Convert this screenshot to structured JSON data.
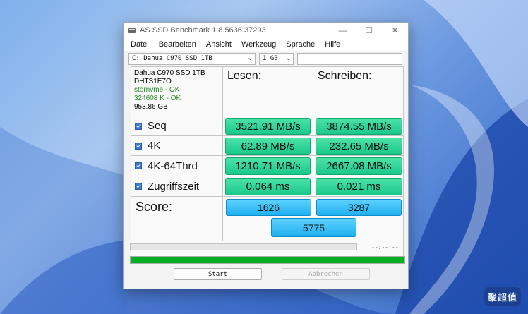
{
  "window": {
    "title": "AS SSD Benchmark 1.8.5636.37293",
    "controls": {
      "minimize": "—",
      "maximize": "☐",
      "close": "✕"
    }
  },
  "menu": [
    "Datei",
    "Bearbeiten",
    "Ansicht",
    "Werkzeug",
    "Sprache",
    "Hilfe"
  ],
  "toolbar": {
    "drive": "C: Dahua C970 SSD 1TB",
    "size": "1 GB",
    "extra": ""
  },
  "drive_info": {
    "model": "Dahua C970 SSD 1TB",
    "firmware": "DHTS1E7O",
    "driver": "stornvme - OK",
    "alignment": "324608 K - OK",
    "capacity": "953.86 GB"
  },
  "headers": {
    "read": "Lesen:",
    "write": "Schreiben:"
  },
  "tests": [
    {
      "label": "Seq",
      "read": "3521.91 MB/s",
      "write": "3874.55 MB/s"
    },
    {
      "label": "4K",
      "read": "62.89 MB/s",
      "write": "232.65 MB/s"
    },
    {
      "label": "4K-64Thrd",
      "read": "1210.71 MB/s",
      "write": "2667.08 MB/s"
    },
    {
      "label": "Zugriffszeit",
      "read": "0.064 ms",
      "write": "0.021 ms"
    }
  ],
  "score": {
    "label": "Score:",
    "read": "1626",
    "write": "3287",
    "total": "5775"
  },
  "time_readout": "--:--:--",
  "progress": 1.0,
  "buttons": {
    "start": "Start",
    "abort": "Abbrechen"
  },
  "watermark": "聚超值",
  "colors": {
    "value_green": "#19c98a",
    "score_blue": "#1fb0f0",
    "progress_green": "#06b025"
  }
}
